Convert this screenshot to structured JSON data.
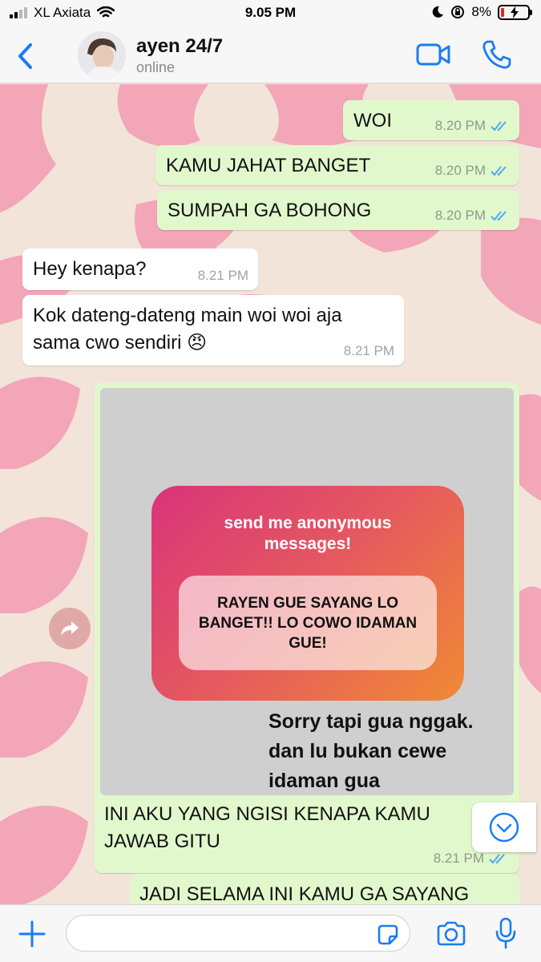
{
  "status_bar": {
    "carrier": "XL Axiata",
    "time": "9.05 PM",
    "battery": "8%"
  },
  "header": {
    "contact_name": "ayen 24/7",
    "contact_status": "online",
    "icons": [
      "chevron-left-icon",
      "video-camera-icon",
      "phone-icon"
    ]
  },
  "messages": [
    {
      "direction": "out",
      "text": "WOI",
      "time": "8.20 PM",
      "read": true
    },
    {
      "direction": "out",
      "text": "KAMU JAHAT BANGET",
      "time": "8.20 PM",
      "read": true
    },
    {
      "direction": "out",
      "text": "SUMPAH GA BOHONG",
      "time": "8.20 PM",
      "read": true
    },
    {
      "direction": "in",
      "text": "Hey kenapa?",
      "time": "8.21 PM"
    },
    {
      "direction": "in",
      "line1": "Kok dateng-dateng main woi woi aja",
      "line2": "sama cwo sendiri 😠",
      "time": "8.21 PM"
    }
  ],
  "image_message": {
    "card_title_line1": "send me anonymous",
    "card_title_line2": "messages!",
    "card_answer": "RAYEN GUE SAYANG LO BANGET!! LO COWO IDAMAN GUE!",
    "reply_line1": "Sorry tapi gua nggak.",
    "reply_line2": "dan lu bukan cewe",
    "reply_line3": "idaman gua",
    "caption_line1": "INI AKU YANG NGISI KENAPA KAMU",
    "caption_line2": "JAWAB GITU",
    "time": "8.21 PM",
    "read": true
  },
  "partial_message": {
    "text": "JADI SELAMA INI KAMU GA SAYANG"
  },
  "composer": {
    "placeholder": "",
    "icons": [
      "plus-icon",
      "sticker-icon",
      "camera-icon",
      "microphone-icon"
    ]
  },
  "colors": {
    "accent": "#1a7cf5",
    "outgoing_bubble": "#e1f8cc",
    "incoming_bubble": "#ffffff",
    "wallpaper_pink": "#f2a6b8",
    "wallpaper_cream": "#f2e4d8",
    "read_ticks": "#4fa9f0"
  }
}
